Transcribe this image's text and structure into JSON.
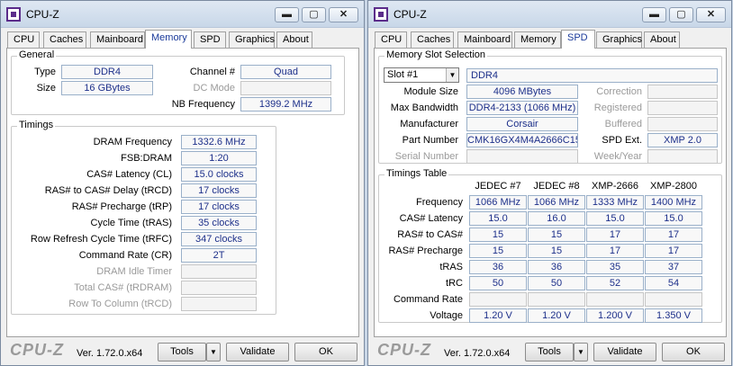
{
  "windowL": {
    "title": "CPU-Z",
    "tabs": [
      "CPU",
      "Caches",
      "Mainboard",
      "Memory",
      "SPD",
      "Graphics",
      "About"
    ],
    "active_tab": "Memory",
    "general": {
      "label": "General",
      "type_label": "Type",
      "type_value": "DDR4",
      "size_label": "Size",
      "size_value": "16 GBytes",
      "channel_label": "Channel #",
      "channel_value": "Quad",
      "dcmode_label": "DC Mode",
      "dcmode_value": "",
      "nbfreq_label": "NB Frequency",
      "nbfreq_value": "1399.2 MHz"
    },
    "timings": {
      "label": "Timings",
      "rows": [
        {
          "label": "DRAM Frequency",
          "value": "1332.6 MHz",
          "disabled": false
        },
        {
          "label": "FSB:DRAM",
          "value": "1:20",
          "disabled": false
        },
        {
          "label": "CAS# Latency (CL)",
          "value": "15.0 clocks",
          "disabled": false
        },
        {
          "label": "RAS# to CAS# Delay (tRCD)",
          "value": "17 clocks",
          "disabled": false
        },
        {
          "label": "RAS# Precharge (tRP)",
          "value": "17 clocks",
          "disabled": false
        },
        {
          "label": "Cycle Time (tRAS)",
          "value": "35 clocks",
          "disabled": false
        },
        {
          "label": "Row Refresh Cycle Time (tRFC)",
          "value": "347 clocks",
          "disabled": false
        },
        {
          "label": "Command Rate (CR)",
          "value": "2T",
          "disabled": false
        },
        {
          "label": "DRAM Idle Timer",
          "value": "",
          "disabled": true
        },
        {
          "label": "Total CAS# (tRDRAM)",
          "value": "",
          "disabled": true
        },
        {
          "label": "Row To Column (tRCD)",
          "value": "",
          "disabled": true
        }
      ]
    }
  },
  "windowR": {
    "title": "CPU-Z",
    "tabs": [
      "CPU",
      "Caches",
      "Mainboard",
      "Memory",
      "SPD",
      "Graphics",
      "About"
    ],
    "active_tab": "SPD",
    "slot": {
      "label": "Memory Slot Selection",
      "selected": "Slot #1",
      "type_value": "DDR4",
      "module_size_label": "Module Size",
      "module_size_value": "4096 MBytes",
      "max_bw_label": "Max Bandwidth",
      "max_bw_value": "DDR4-2133 (1066 MHz)",
      "manufacturer_label": "Manufacturer",
      "manufacturer_value": "Corsair",
      "part_label": "Part Number",
      "part_value": "CMK16GX4M4A2666C15",
      "serial_label": "Serial Number",
      "serial_value": "",
      "correction_label": "Correction",
      "correction_value": "",
      "registered_label": "Registered",
      "registered_value": "",
      "buffered_label": "Buffered",
      "buffered_value": "",
      "spdext_label": "SPD Ext.",
      "spdext_value": "XMP 2.0",
      "weekyear_label": "Week/Year",
      "weekyear_value": ""
    },
    "timings_table": {
      "label": "Timings Table",
      "columns": [
        "JEDEC #7",
        "JEDEC #8",
        "XMP-2666",
        "XMP-2800"
      ],
      "rows": [
        {
          "label": "Frequency",
          "values": [
            "1066 MHz",
            "1066 MHz",
            "1333 MHz",
            "1400 MHz"
          ]
        },
        {
          "label": "CAS# Latency",
          "values": [
            "15.0",
            "16.0",
            "15.0",
            "15.0"
          ]
        },
        {
          "label": "RAS# to CAS#",
          "values": [
            "15",
            "15",
            "17",
            "17"
          ]
        },
        {
          "label": "RAS# Precharge",
          "values": [
            "15",
            "15",
            "17",
            "17"
          ]
        },
        {
          "label": "tRAS",
          "values": [
            "36",
            "36",
            "35",
            "37"
          ]
        },
        {
          "label": "tRC",
          "values": [
            "50",
            "50",
            "52",
            "54"
          ]
        },
        {
          "label": "Command Rate",
          "values": [
            "",
            "",
            "",
            ""
          ]
        },
        {
          "label": "Voltage",
          "values": [
            "1.20 V",
            "1.20 V",
            "1.200 V",
            "1.350 V"
          ]
        }
      ]
    }
  },
  "footer": {
    "logo": "CPU-Z",
    "version": "Ver. 1.72.0.x64",
    "tools_label": "Tools",
    "validate_label": "Validate",
    "ok_label": "OK"
  },
  "titlebar_buttons": {
    "min": "▭",
    "max": "▢",
    "close": "✕"
  },
  "icons": {
    "dropdown": "chevron-down-icon",
    "app": "cpuz-app-icon"
  }
}
